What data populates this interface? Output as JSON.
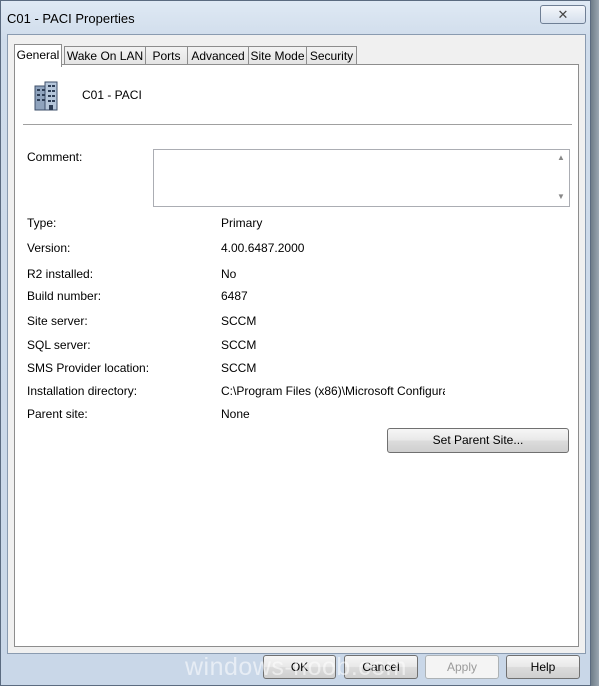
{
  "window": {
    "title": "C01 - PACI Properties",
    "close_glyph": "✕"
  },
  "tabs": [
    {
      "label": "General"
    },
    {
      "label": "Wake On LAN"
    },
    {
      "label": "Ports"
    },
    {
      "label": "Advanced"
    },
    {
      "label": "Site Mode"
    },
    {
      "label": "Security"
    }
  ],
  "header": {
    "icon": "server-building-icon",
    "site_name": "C01 - PACI"
  },
  "comment": {
    "label": "Comment:",
    "value": ""
  },
  "properties": [
    {
      "label": "Type:",
      "value": "Primary"
    },
    {
      "label": "Version:",
      "value": "4.00.6487.2000"
    },
    {
      "label": "R2 installed:",
      "value": "No"
    },
    {
      "label": "Build number:",
      "value": "6487"
    },
    {
      "label": "Site server:",
      "value": "SCCM"
    },
    {
      "label": "SQL server:",
      "value": "SCCM"
    },
    {
      "label": "SMS Provider location:",
      "value": "SCCM"
    },
    {
      "label": "Installation directory:",
      "value": "C:\\Program Files (x86)\\Microsoft Configura"
    },
    {
      "label": "Parent site:",
      "value": "None"
    }
  ],
  "buttons": {
    "set_parent": "Set Parent Site...",
    "ok": "OK",
    "cancel": "Cancel",
    "apply": "Apply",
    "help": "Help"
  },
  "watermark": "windows-noob.com"
}
